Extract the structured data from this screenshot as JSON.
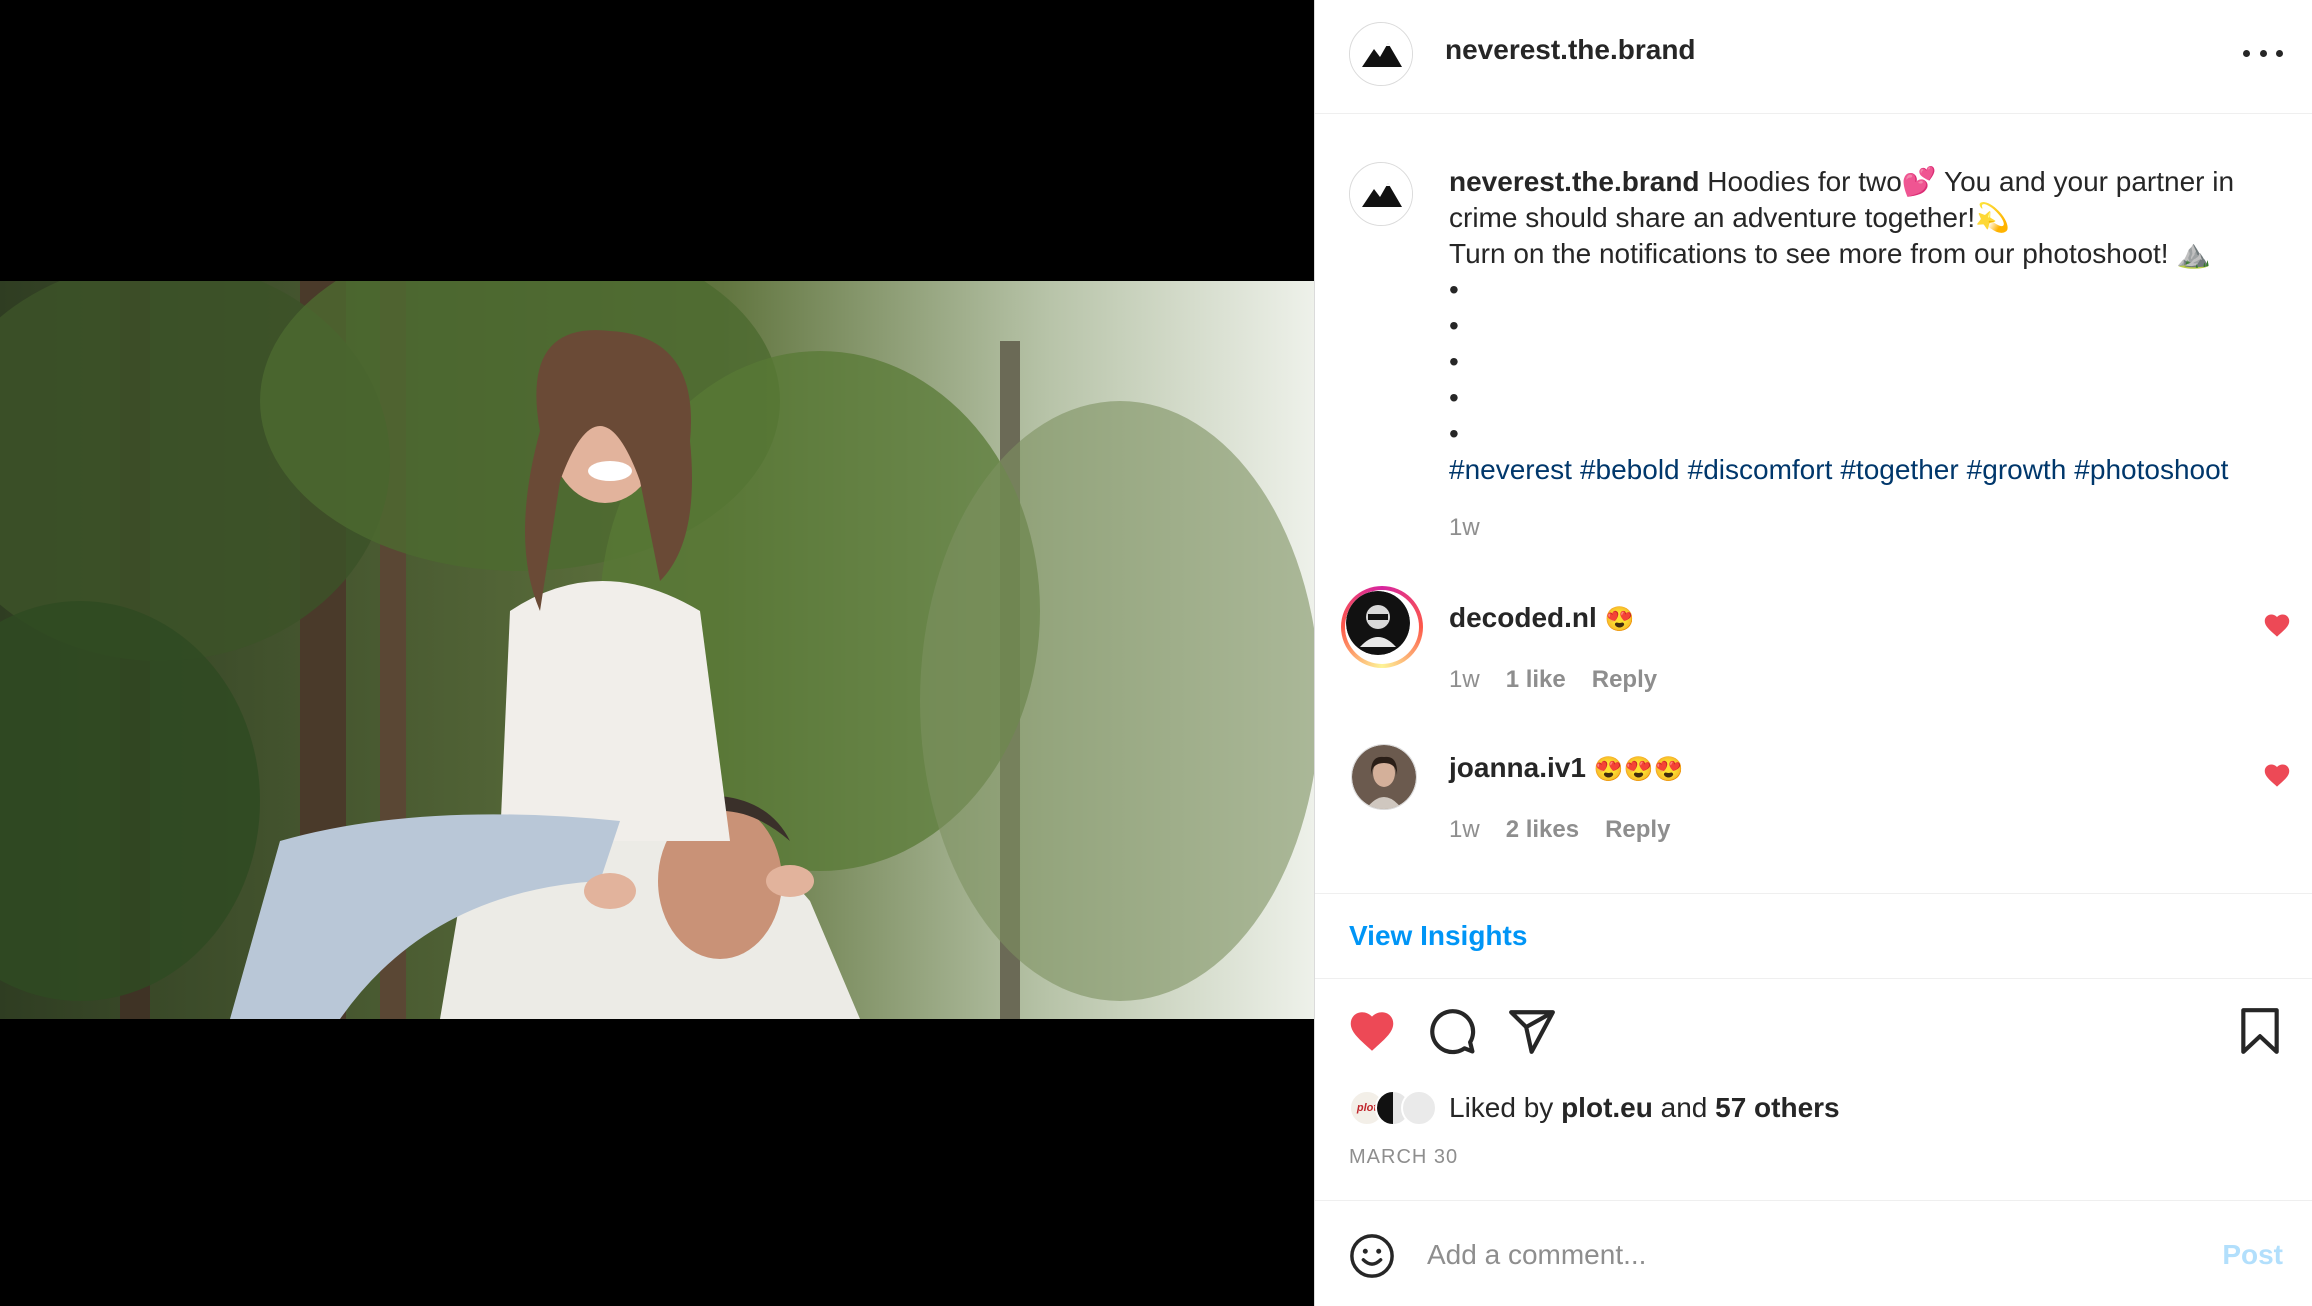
{
  "post": {
    "author": "neverest.the.brand",
    "image_alt": "Woman in a white hoodie sitting on the shoulders of a smiling man in a forest"
  },
  "header": {
    "username": "neverest.the.brand",
    "more_icon": "more-horizontal-icon"
  },
  "caption": {
    "username": "neverest.the.brand",
    "line1": " Hoodies for two💕 You and your partner in crime should share an adventure together!💫",
    "line2": "Turn on the notifications to see more from our photoshoot! ⛰️",
    "dots": [
      "•",
      "•",
      "•",
      "•",
      "•"
    ],
    "hashtags": [
      "#neverest",
      "#bebold",
      "#discomfort",
      "#together",
      "#growth",
      "#photoshoot"
    ],
    "time": "1w"
  },
  "comments": [
    {
      "username": "decoded.nl",
      "text": "😍",
      "time": "1w",
      "likes": "1 like",
      "reply": "Reply"
    },
    {
      "username": "joanna.iv1",
      "text": "😍😍😍",
      "time": "1w",
      "likes": "2 likes",
      "reply": "Reply"
    }
  ],
  "insights": {
    "label": "View Insights"
  },
  "actions": {
    "like_icon": "heart-filled-icon",
    "comment_icon": "comment-icon",
    "share_icon": "paper-plane-icon",
    "save_icon": "bookmark-icon",
    "like_color": "#ed4956"
  },
  "likes": {
    "prefix": "Liked by ",
    "user": "plot.eu",
    "joiner": " and ",
    "others": "57 others",
    "avatar_label": "plot"
  },
  "date": "MARCH 30",
  "comment_box": {
    "placeholder": "Add a comment...",
    "post_label": "Post",
    "emoji_icon": "smiley-icon"
  },
  "colors": {
    "link": "#0095f6",
    "hashtag": "#00376b",
    "muted": "#8e8e8e",
    "post_disabled": "#b2dffc"
  }
}
